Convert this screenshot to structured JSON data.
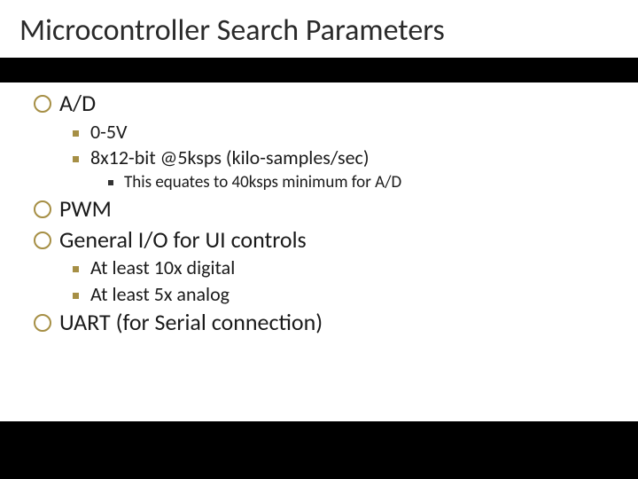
{
  "title": "Microcontroller Search Parameters",
  "items": [
    {
      "level": 1,
      "text": "A/D"
    },
    {
      "level": 2,
      "text": "0-5V"
    },
    {
      "level": 2,
      "text": "8x12-bit @5ksps (kilo-samples/sec)"
    },
    {
      "level": 3,
      "text": "This equates to 40ksps minimum for A/D"
    },
    {
      "level": 1,
      "text": "PWM"
    },
    {
      "level": 1,
      "text": "General I/O for UI controls"
    },
    {
      "level": 2,
      "text": "At least 10x digital"
    },
    {
      "level": 2,
      "text": "At least 5x analog"
    },
    {
      "level": 1,
      "text": "UART (for Serial connection)"
    }
  ]
}
